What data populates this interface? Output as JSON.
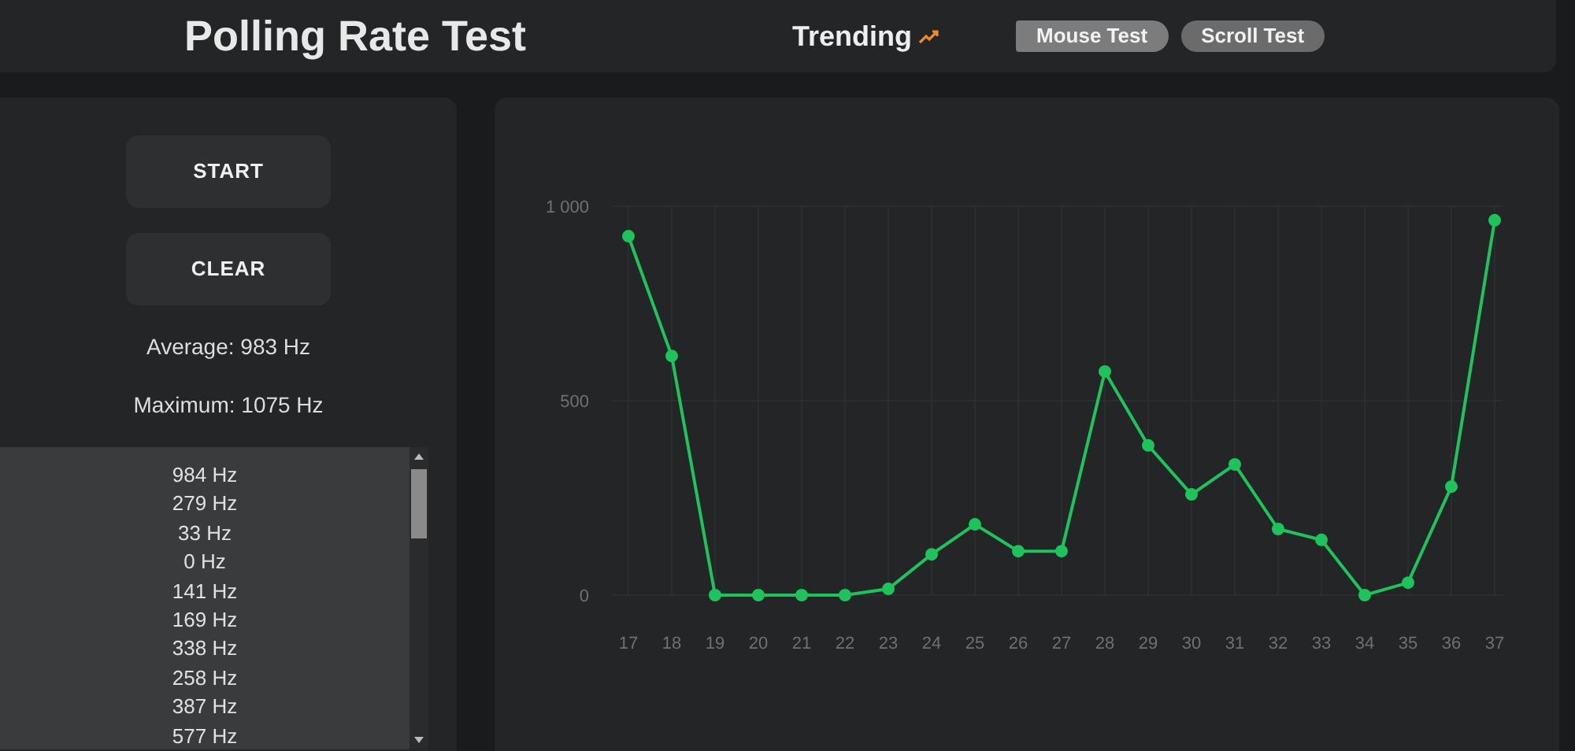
{
  "header": {
    "title": "Polling Rate Test",
    "trending": "Trending",
    "tabs": [
      {
        "label": "Mouse Test",
        "selected": true
      },
      {
        "label": "Scroll Test",
        "selected": false
      }
    ]
  },
  "controls": {
    "buttons": [
      "START",
      "CLEAR"
    ],
    "average": "Average: 983 Hz",
    "maximum": "Maximum: 1075 Hz"
  },
  "readings": [
    "984 Hz",
    "279 Hz",
    "33 Hz",
    "0 Hz",
    "141 Hz",
    "169 Hz",
    "338 Hz",
    "258 Hz",
    "387 Hz",
    "577 Hz"
  ],
  "chart": {
    "chart_data": {
      "type": "line",
      "categories": [
        "17",
        "18",
        "19",
        "20",
        "21",
        "22",
        "23",
        "24",
        "25",
        "26",
        "27",
        "28",
        "29",
        "30",
        "31",
        "32",
        "33",
        "34",
        "35",
        "36",
        "37"
      ],
      "grid": true,
      "series": [
        {
          "marker": true,
          "color": "#1fc35c",
          "values": [
            923,
            615,
            0,
            0,
            0,
            0,
            16,
            105,
            182,
            113,
            113,
            575,
            385,
            259,
            336,
            170,
            142,
            0,
            32,
            279,
            964
          ]
        }
      ],
      "ylim": [
        0,
        1000
      ],
      "yticks": [
        0,
        500,
        {
          "value": 1000,
          "label": "1 000"
        }
      ]
    }
  }
}
